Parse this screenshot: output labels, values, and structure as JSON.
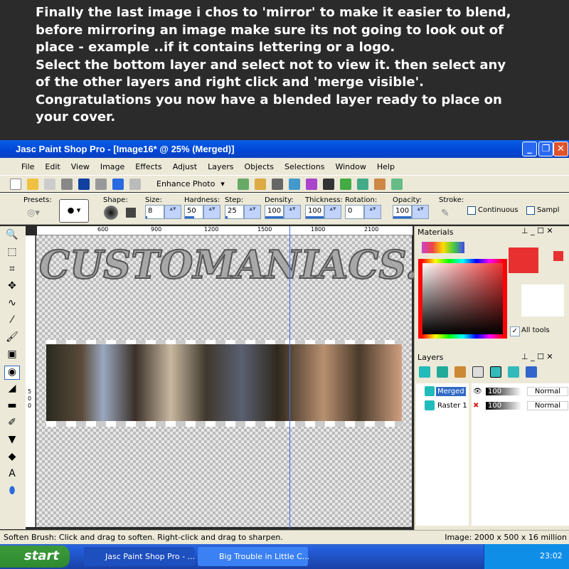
{
  "intro_text": "Finally the last image i chos to 'mirror' to make it easier to blend,\nbefore mirroring an image make sure its not going to look out of\nplace - example ..if it contains lettering or a logo.\nSelect the bottom layer and select not to view it. then select any\nof the other layers and right click and 'merge visible'.\nCongratulations you now have a blended layer ready to place on\nyour cover.",
  "window": {
    "title": "Jasc Paint Shop Pro - [Image16* @  25% (Merged)]"
  },
  "menu": [
    "File",
    "Edit",
    "View",
    "Image",
    "Effects",
    "Adjust",
    "Layers",
    "Objects",
    "Selections",
    "Window",
    "Help"
  ],
  "toolbar": {
    "enhance_photo": "Enhance Photo"
  },
  "tool_options": {
    "presets": "Presets:",
    "shape": "Shape:",
    "fields": [
      {
        "label": "Size:",
        "value": "8",
        "fill": 8
      },
      {
        "label": "Hardness:",
        "value": "50",
        "fill": 50
      },
      {
        "label": "Step:",
        "value": "25",
        "fill": 10
      },
      {
        "label": "Density:",
        "value": "100",
        "fill": 100
      },
      {
        "label": "Thickness:",
        "value": "100",
        "fill": 100
      },
      {
        "label": "Rotation:",
        "value": "0",
        "fill": 0
      },
      {
        "label": "Opacity:",
        "value": "100",
        "fill": 100
      }
    ],
    "stroke": "Stroke:",
    "continuous": "Continuous",
    "sample": "Sampl"
  },
  "ruler": {
    "h": [
      "600",
      "900",
      "1200",
      "1500",
      "1800",
      "2100"
    ],
    "v": "500"
  },
  "watermark": "CUSTOMANIACS.ORG",
  "materials": {
    "title": "Materials",
    "all_tools": "All tools",
    "fg_color": "#e83030"
  },
  "layers": {
    "title": "Layers",
    "items": [
      {
        "name": "Merged",
        "opacity": "100",
        "blend": "Normal",
        "visible": true,
        "selected": true
      },
      {
        "name": "Raster 1",
        "opacity": "100",
        "blend": "Normal",
        "visible": false,
        "selected": false
      }
    ]
  },
  "status": {
    "left": "Soften Brush: Click and drag to soften. Right-click and drag to sharpen.",
    "right": "Image:  2000 x 500 x 16 million"
  },
  "taskbar": {
    "start": "start",
    "tasks": [
      "Jasc Paint Shop Pro - ...",
      "Big Trouble in Little C..."
    ],
    "clock": "23:02"
  }
}
